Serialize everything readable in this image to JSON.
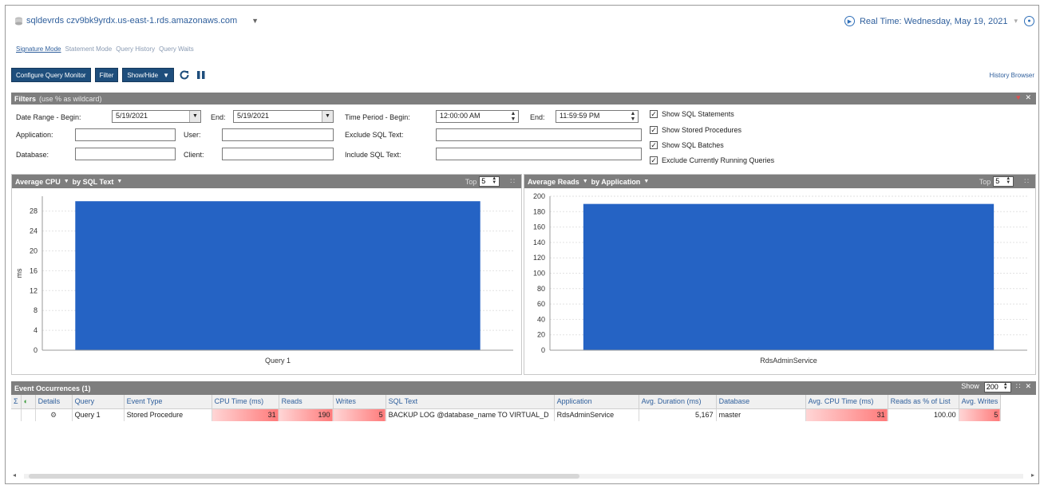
{
  "header": {
    "server": "sqldevrds czv9bk9yrdx.us-east-1.rds.amazonaws.com",
    "realtime_label": "Real Time: Wednesday, May 19, 2021"
  },
  "tabs": [
    "Signature Mode",
    "Statement Mode",
    "Query History",
    "Query Waits"
  ],
  "toolbar": {
    "configure_label": "Configure Query Monitor",
    "filter_label": "Filter",
    "showhide_label": "Show/Hide",
    "history_browser": "History Browser"
  },
  "filters": {
    "title": "Filters",
    "hint": "(use % as wildcard)",
    "date_range_begin_label": "Date Range - Begin:",
    "date_begin": "5/19/2021",
    "end_label": "End:",
    "date_end": "5/19/2021",
    "time_period_begin_label": "Time Period - Begin:",
    "time_begin": "12:00:00 AM",
    "time_end_label": "End:",
    "time_end": "11:59:59 PM",
    "application_label": "Application:",
    "user_label": "User:",
    "exclude_sql_label": "Exclude SQL Text:",
    "database_label": "Database:",
    "client_label": "Client:",
    "include_sql_label": "Include SQL Text:",
    "checks": [
      {
        "label": "Show SQL Statements",
        "checked": true
      },
      {
        "label": "Show Stored Procedures",
        "checked": true
      },
      {
        "label": "Show SQL Batches",
        "checked": true
      },
      {
        "label": "Exclude Currently Running Queries",
        "checked": true
      }
    ]
  },
  "chart_left_head": {
    "metric": "Average CPU",
    "by": "by SQL Text",
    "top_label": "Top",
    "top_value": "5"
  },
  "chart_right_head": {
    "metric": "Average Reads",
    "by": "by Application",
    "top_label": "Top",
    "top_value": "5"
  },
  "chart_data": [
    {
      "type": "bar",
      "title": "Average CPU by SQL Text",
      "categories": [
        "Query 1"
      ],
      "values": [
        30
      ],
      "ylabel": "ms",
      "ylim": [
        0,
        31
      ],
      "yticks": [
        0,
        4,
        8,
        12,
        16,
        20,
        24,
        28
      ],
      "color": "#2563c4",
      "grid": true
    },
    {
      "type": "bar",
      "title": "Average Reads by Application",
      "categories": [
        "RdsAdminService"
      ],
      "values": [
        190
      ],
      "ylabel": "",
      "ylim": [
        0,
        200
      ],
      "yticks": [
        0,
        20,
        40,
        60,
        80,
        100,
        120,
        140,
        160,
        180,
        200
      ],
      "color": "#2563c4",
      "grid": true
    }
  ],
  "events": {
    "title": "Event Occurrences (1)",
    "show_label": "Show",
    "show_value": "200",
    "columns": [
      "Σ",
      "",
      "Details",
      "Query",
      "Event Type",
      "CPU Time (ms)",
      "Reads",
      "Writes",
      "SQL Text",
      "Application",
      "Avg. Duration (ms)",
      "Database",
      "Avg. CPU Time (ms)",
      "Reads as % of List",
      "Avg. Writes"
    ],
    "rows": [
      [
        "",
        "",
        "",
        "Query 1",
        "Stored Procedure",
        "31",
        "190",
        "5",
        "BACKUP LOG @database_name TO VIRTUAL_D",
        "RdsAdminService",
        "5,167",
        "master",
        "31",
        "100.00",
        "5"
      ]
    ]
  }
}
